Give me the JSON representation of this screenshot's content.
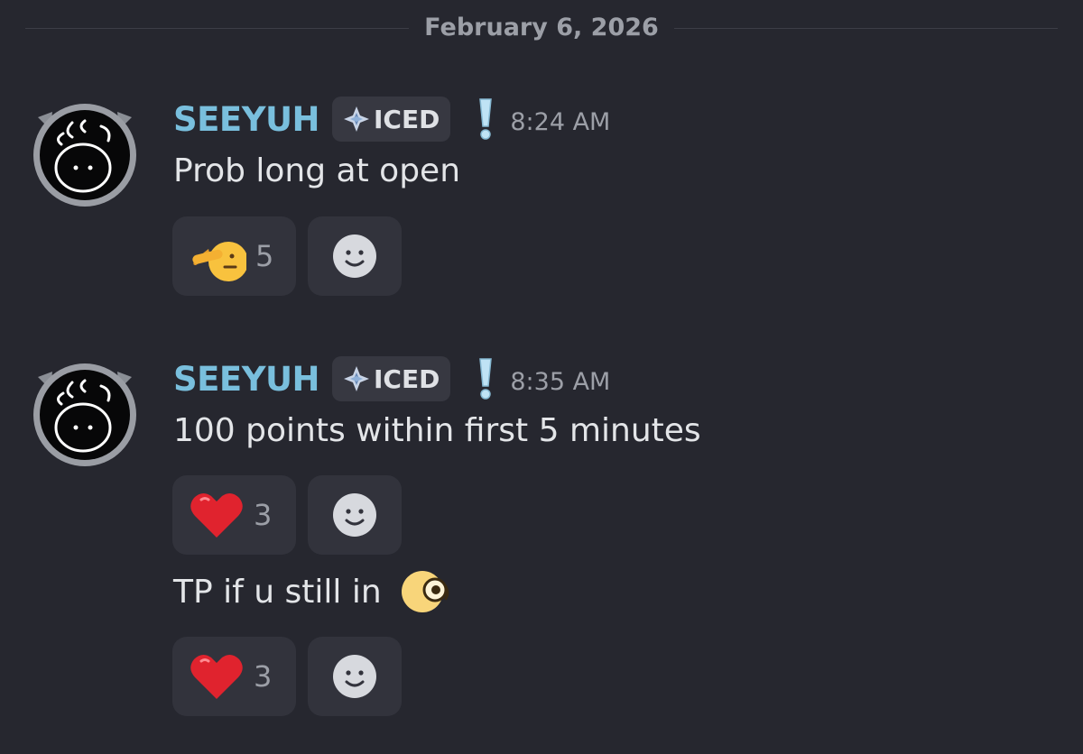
{
  "date_divider": {
    "text": "February 6, 2026"
  },
  "messages": [
    {
      "username": "SEEYUH",
      "tag": {
        "label": "ICED",
        "icon": "diamond-star-icon"
      },
      "badge_icon": "exclamation-icon",
      "timestamp": "8:24 AM",
      "text": "Prob long at open",
      "reactions": [
        {
          "emoji": "saluting-face",
          "count": "5"
        }
      ]
    },
    {
      "username": "SEEYUH",
      "tag": {
        "label": "ICED",
        "icon": "diamond-star-icon"
      },
      "badge_icon": "exclamation-icon",
      "timestamp": "8:35 AM",
      "text": "100 points within first 5 minutes",
      "reactions": [
        {
          "emoji": "red-heart",
          "count": "3"
        }
      ]
    },
    {
      "text": "TP if u still in",
      "inline_emoji": "peeking-face",
      "reactions": [
        {
          "emoji": "red-heart",
          "count": "3"
        }
      ]
    }
  ],
  "colors": {
    "background": "#26272f",
    "username": "#79bfdd",
    "reaction_bg": "#32333c",
    "tag_bg": "#373841",
    "muted_text": "#9c9fa7"
  }
}
